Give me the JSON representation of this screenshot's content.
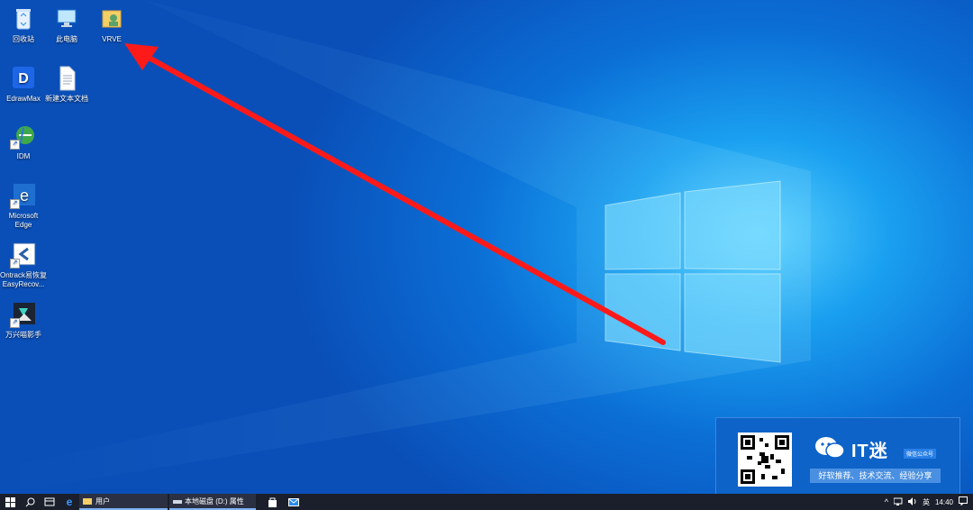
{
  "desktop": {
    "icons": [
      {
        "label": "回收站",
        "icon": "recycle-bin-icon"
      },
      {
        "label": "此电脑",
        "icon": "computer-icon"
      },
      {
        "label": "VRVE",
        "icon": "user-folder-icon"
      },
      {
        "label": "EdrawMax",
        "icon": "edrawmax-icon"
      },
      {
        "label": "新建文本文档",
        "icon": "text-document-icon"
      },
      {
        "label": "IDM",
        "icon": "idm-icon"
      },
      {
        "label": "Microsoft Edge",
        "icon": "edge-icon"
      },
      {
        "label": "Ontrack易恢复EasyRecov...",
        "icon": "easyrecovery-icon"
      },
      {
        "label": "万兴喵影手",
        "icon": "filmora-icon"
      }
    ],
    "annotation": {
      "type": "red-arrow",
      "color": "#ff1a1a"
    },
    "accent_color": "#0b6fd6"
  },
  "taskbar": {
    "start_icon": "windows-start-icon",
    "search_icon": "search-icon",
    "taskview_icon": "task-view-icon",
    "edge_icon": "edge-taskbar-icon",
    "tasks": [
      {
        "label": "用户",
        "icon": "folder-icon"
      },
      {
        "label": "本地磁盘 (D:) 属性",
        "icon": "drive-icon"
      }
    ],
    "pinned": [
      {
        "icon": "store-icon"
      },
      {
        "icon": "mail-icon"
      }
    ],
    "tray": {
      "ime": "英",
      "time": "14:40"
    }
  },
  "watermark": {
    "brand": "IT迷",
    "badge": "微信公众号",
    "tagline": "好软推荐、技术交流、经验分享"
  }
}
